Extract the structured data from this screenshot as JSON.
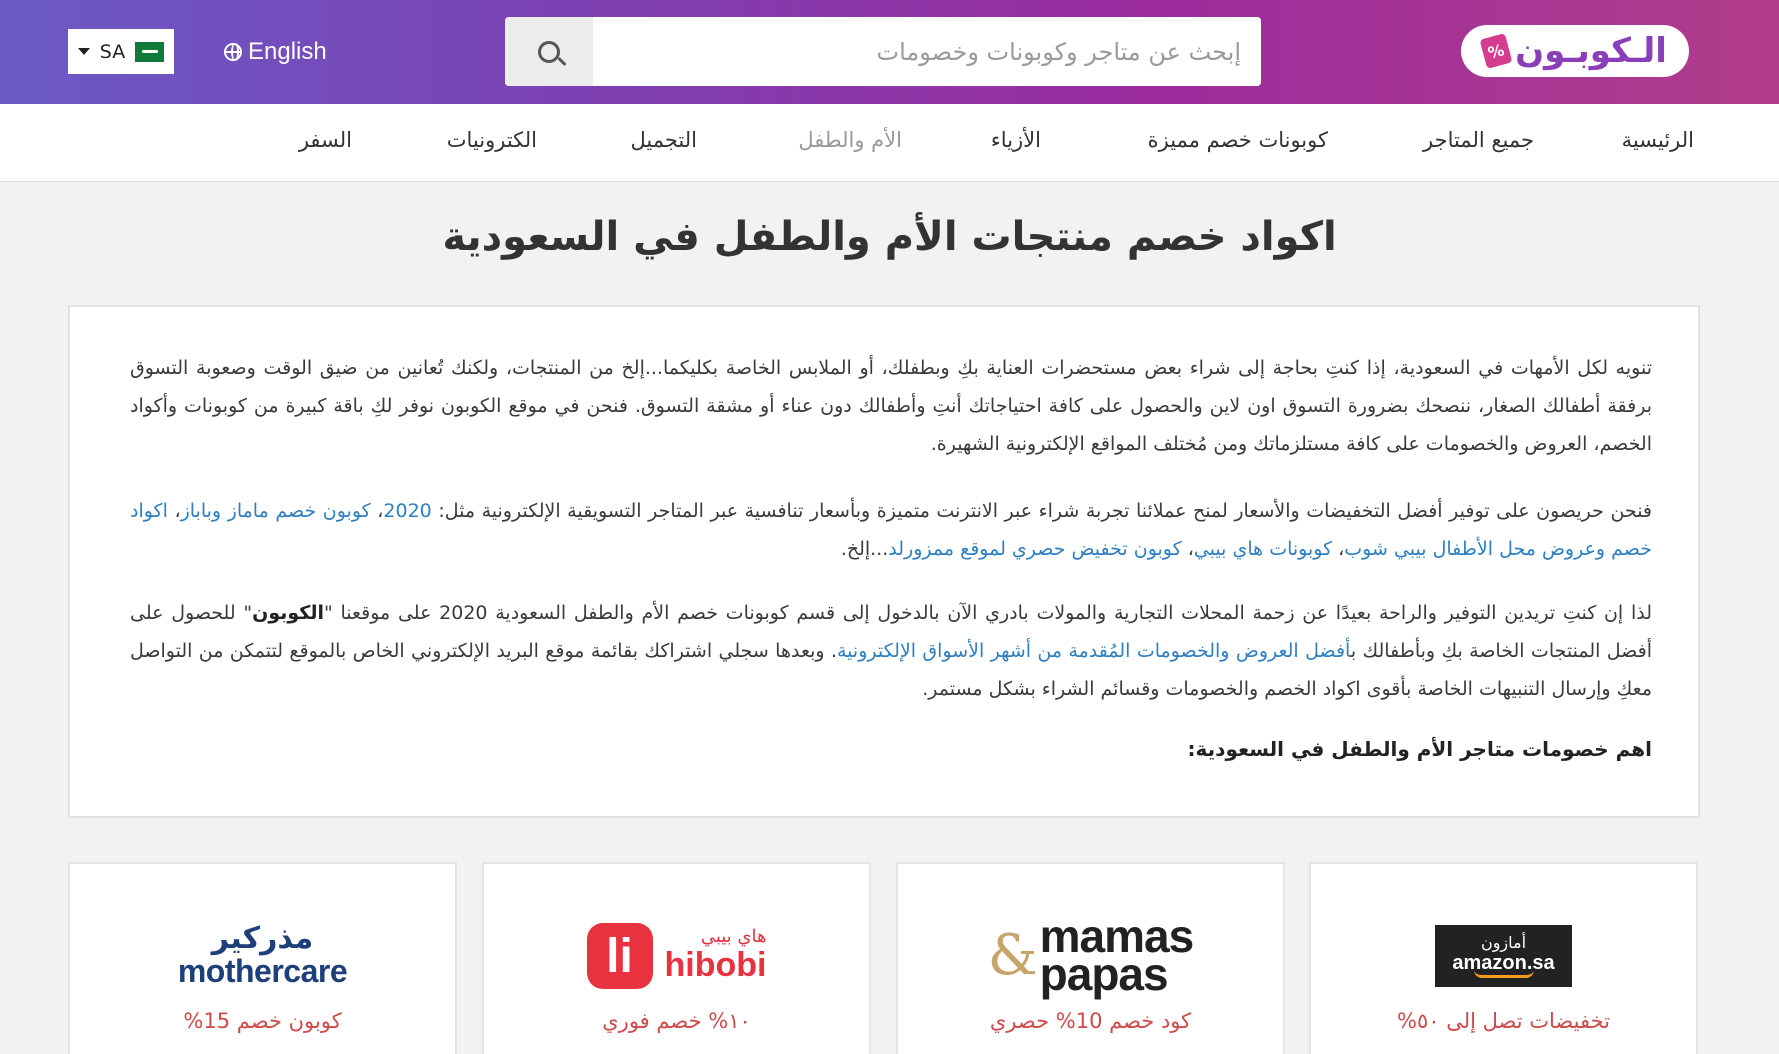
{
  "header": {
    "country_code": "SA",
    "language_label": "English",
    "search_placeholder": "إبحث عن متاجر وكوبونات وخصومات",
    "logo_text": "الـكوبـون"
  },
  "nav": {
    "items": [
      "الرئيسية",
      "جميع المتاجر",
      "كوبونات خصم مميزة",
      "الأزياء",
      "الأم والطفل",
      "التجميل",
      "الكترونيات",
      "السفر"
    ],
    "active": "الأم والطفل"
  },
  "page": {
    "title": "اكواد خصم منتجات الأم والطفل في السعودية"
  },
  "content": {
    "p1": "تنويه لكل الأمهات في السعودية، إذا كنتِ بحاجة إلى شراء بعض مستحضرات العناية بكِ وبطفلك، أو الملابس الخاصة بكليكما...إلخ من المنتجات، ولكنك تُعانين من ضيق الوقت وصعوبة التسوق برفقة أطفالك الصغار، ننصحك بضرورة التسوق اون لاين والحصول على كافة احتياجاتك أنتِ وأطفالك دون عناء أو مشقة التسوق. فنحن في موقع الكوبون نوفر لكِ باقة كبيرة من كوبونات وأكواد الخصم، العروض والخصومات على كافة مستلزماتك ومن مُختلف المواقع الإلكترونية الشهيرة.",
    "p2_text": "فنحن حريصون على توفير أفضل التخفيضات والأسعار لمنح عملائنا تجربة شراء عبر الانترنت متميزة وبأسعار تنافسية عبر المتاجر التسويقية الإلكترونية مثل: ",
    "p2_links": [
      "2020",
      "كوبون خصم ماماز وباباز",
      "اكواد خصم وعروض محل الأطفال بيبي شوب",
      "كوبونات هاي بيبي",
      "كوبون تخفيض حصري لموقع ممزورلد"
    ],
    "p2_end": "...إلخ.",
    "p3_a": "لذا إن كنتِ تريدين التوفير والراحة بعيدًا عن زحمة المحلات التجارية والمولات بادري الآن بالدخول إلى قسم كوبونات خصم الأم والطفل السعودية 2020 على موقعنا \"",
    "p3_brand": "الكوبون",
    "p3_b": "\" للحصول على أفضل المنتجات الخاصة بكِ وبأطفالك ب",
    "p3_link": "أفضل العروض والخصومات المُقدمة من أشهر الأسواق الإلكترونية",
    "p3_c": ". وبعدها سجلي اشتراكك بقائمة موقع البريد الإلكتروني الخاص بالموقع لتتمكن من التواصل معكِ وإرسال التنبيهات الخاصة بأقوى اكواد الخصم والخصومات وقسائم الشراء بشكل مستمر.",
    "subheading": "اهم خصومات متاجر الأم والطفل في السعودية:"
  },
  "stores": [
    {
      "name_ar": "أمازون",
      "name_en": "amazon.sa",
      "offer": "تخفيضات تصل إلى ٥٠%"
    },
    {
      "name_en_1": "mamas",
      "name_en_2": "papas",
      "offer": "كود خصم 10% حصري"
    },
    {
      "name_ar": "هاي بيبي",
      "name_en": "hibobi",
      "offer": "١٠% خصم فوري"
    },
    {
      "name_ar": "مذركير",
      "name_en": "mothercare",
      "offer": "كوبون خصم 15%"
    }
  ]
}
